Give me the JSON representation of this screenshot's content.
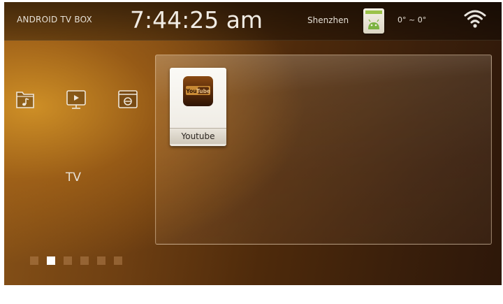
{
  "topbar": {
    "brand": "ANDROID TV BOX",
    "clock": "7:44:25 am",
    "city": "Shenzhen",
    "temperature": "0° ~ 0°",
    "weather_icon": "android-weather-icon",
    "wifi_icon": "wifi-icon"
  },
  "sidebar": {
    "icons": [
      {
        "name": "music-folder-icon"
      },
      {
        "name": "video-player-icon"
      },
      {
        "name": "web-browser-icon"
      }
    ],
    "category_label": "TV",
    "pager": {
      "total": 6,
      "active_index": 1
    }
  },
  "apps": [
    {
      "label": "Youtube",
      "icon": "youtube-icon"
    }
  ],
  "colors": {
    "accent": "#c8852a",
    "text": "#e6e0d6",
    "tile_bg": "#f5f3ee"
  }
}
